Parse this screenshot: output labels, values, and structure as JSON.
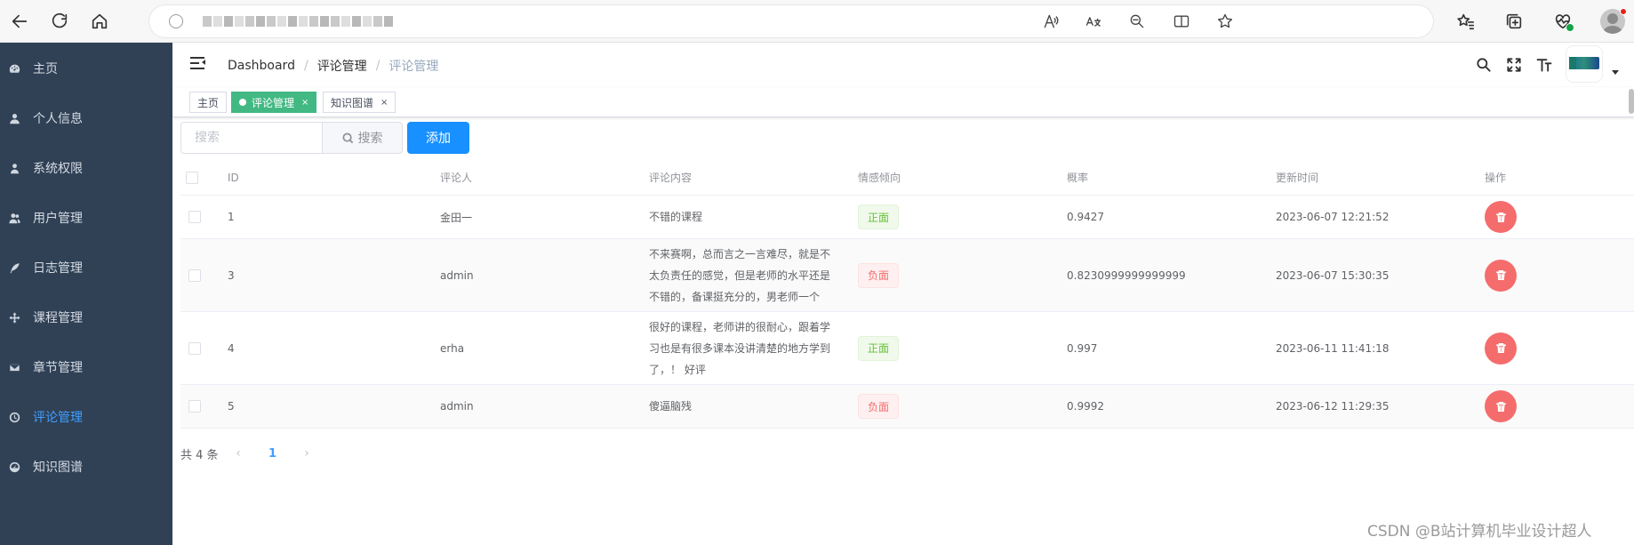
{
  "browser": {
    "right_icons": [
      "read-aloud-icon",
      "translate-icon",
      "zoom-out-icon",
      "split-screen-icon",
      "favorite-star-icon",
      "favorites-list-icon",
      "collections-icon",
      "browser-health-icon",
      "profile-icon"
    ]
  },
  "sidebar": {
    "items": [
      {
        "label": "主页",
        "icon": "dashboard-icon"
      },
      {
        "label": "个人信息",
        "icon": "user-icon"
      },
      {
        "label": "系统权限",
        "icon": "user-icon"
      },
      {
        "label": "用户管理",
        "icon": "users-icon"
      },
      {
        "label": "日志管理",
        "icon": "feather-icon"
      },
      {
        "label": "课程管理",
        "icon": "move-icon"
      },
      {
        "label": "章节管理",
        "icon": "envelope-icon"
      },
      {
        "label": "评论管理",
        "icon": "clock-icon"
      },
      {
        "label": "知识图谱",
        "icon": "dashboard-icon"
      }
    ],
    "active_index": 7,
    "bg_color": "#304156",
    "active_color": "#409eff"
  },
  "navbar": {
    "breadcrumb": [
      "Dashboard",
      "评论管理",
      "评论管理"
    ]
  },
  "tags": [
    {
      "label": "主页",
      "active": false,
      "closable": false
    },
    {
      "label": "评论管理",
      "active": true,
      "closable": true
    },
    {
      "label": "知识图谱",
      "active": false,
      "closable": true
    }
  ],
  "toolbar": {
    "search_placeholder": "搜索",
    "search_button": "搜索",
    "add_button": "添加"
  },
  "table": {
    "columns": [
      "ID",
      "评论人",
      "评论内容",
      "情感倾向",
      "概率",
      "更新时间",
      "操作"
    ],
    "rows": [
      {
        "id": "1",
        "author": "金田一",
        "content": [
          "不错的课程"
        ],
        "sentiment": "正面",
        "sentiment_type": "success",
        "probability": "0.9427",
        "updated": "2023-06-07 12:21:52"
      },
      {
        "id": "3",
        "author": "admin",
        "content": [
          "不来赛啊，总而言之一言难尽，就是不",
          "太负责任的感觉，但是老师的水平还是",
          "不错的，备课挺充分的，男老师一个"
        ],
        "sentiment": "负面",
        "sentiment_type": "danger",
        "probability": "0.8230999999999999",
        "updated": "2023-06-07 15:30:35"
      },
      {
        "id": "4",
        "author": "erha",
        "content": [
          "很好的课程，老师讲的很耐心，跟着学",
          "习也是有很多课本没讲清楚的地方学到",
          "了，！ 好评"
        ],
        "sentiment": "正面",
        "sentiment_type": "success",
        "probability": "0.997",
        "updated": "2023-06-11 11:41:18"
      },
      {
        "id": "5",
        "author": "admin",
        "content": [
          "傻逼脑残"
        ],
        "sentiment": "负面",
        "sentiment_type": "danger",
        "probability": "0.9992",
        "updated": "2023-06-12 11:29:35"
      }
    ]
  },
  "pagination": {
    "total_text": "共 4 条",
    "current_page": "1"
  },
  "watermark": "CSDN @B站计算机毕业设计超人"
}
